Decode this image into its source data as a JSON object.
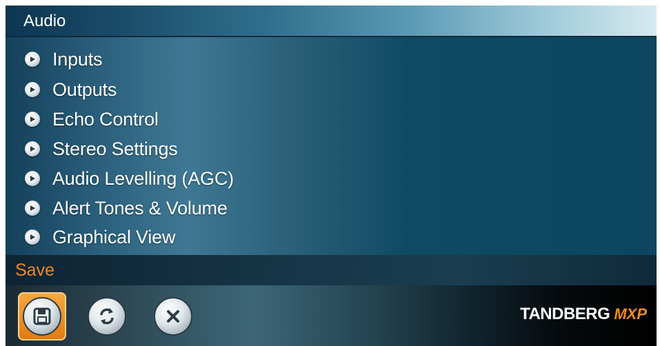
{
  "window": {
    "title": "Audio"
  },
  "menu": {
    "items": [
      {
        "label": "Inputs",
        "icon": "play-bullet-icon"
      },
      {
        "label": "Outputs",
        "icon": "play-bullet-icon"
      },
      {
        "label": "Echo Control",
        "icon": "play-bullet-icon"
      },
      {
        "label": "Stereo Settings",
        "icon": "play-bullet-icon"
      },
      {
        "label": "Audio Levelling (AGC)",
        "icon": "play-bullet-icon"
      },
      {
        "label": "Alert Tones & Volume",
        "icon": "play-bullet-icon"
      },
      {
        "label": "Graphical View",
        "icon": "play-bullet-icon"
      }
    ]
  },
  "status": {
    "label": "Save",
    "color": "#f08a1e"
  },
  "toolbar": {
    "buttons": [
      {
        "icon": "floppy-disk-icon",
        "selected": true
      },
      {
        "icon": "refresh-icon",
        "selected": false
      },
      {
        "icon": "close-icon",
        "selected": false
      }
    ]
  },
  "brand": {
    "name": "TANDBERG",
    "suffix": "MXP",
    "accent": "#f08a1e"
  }
}
